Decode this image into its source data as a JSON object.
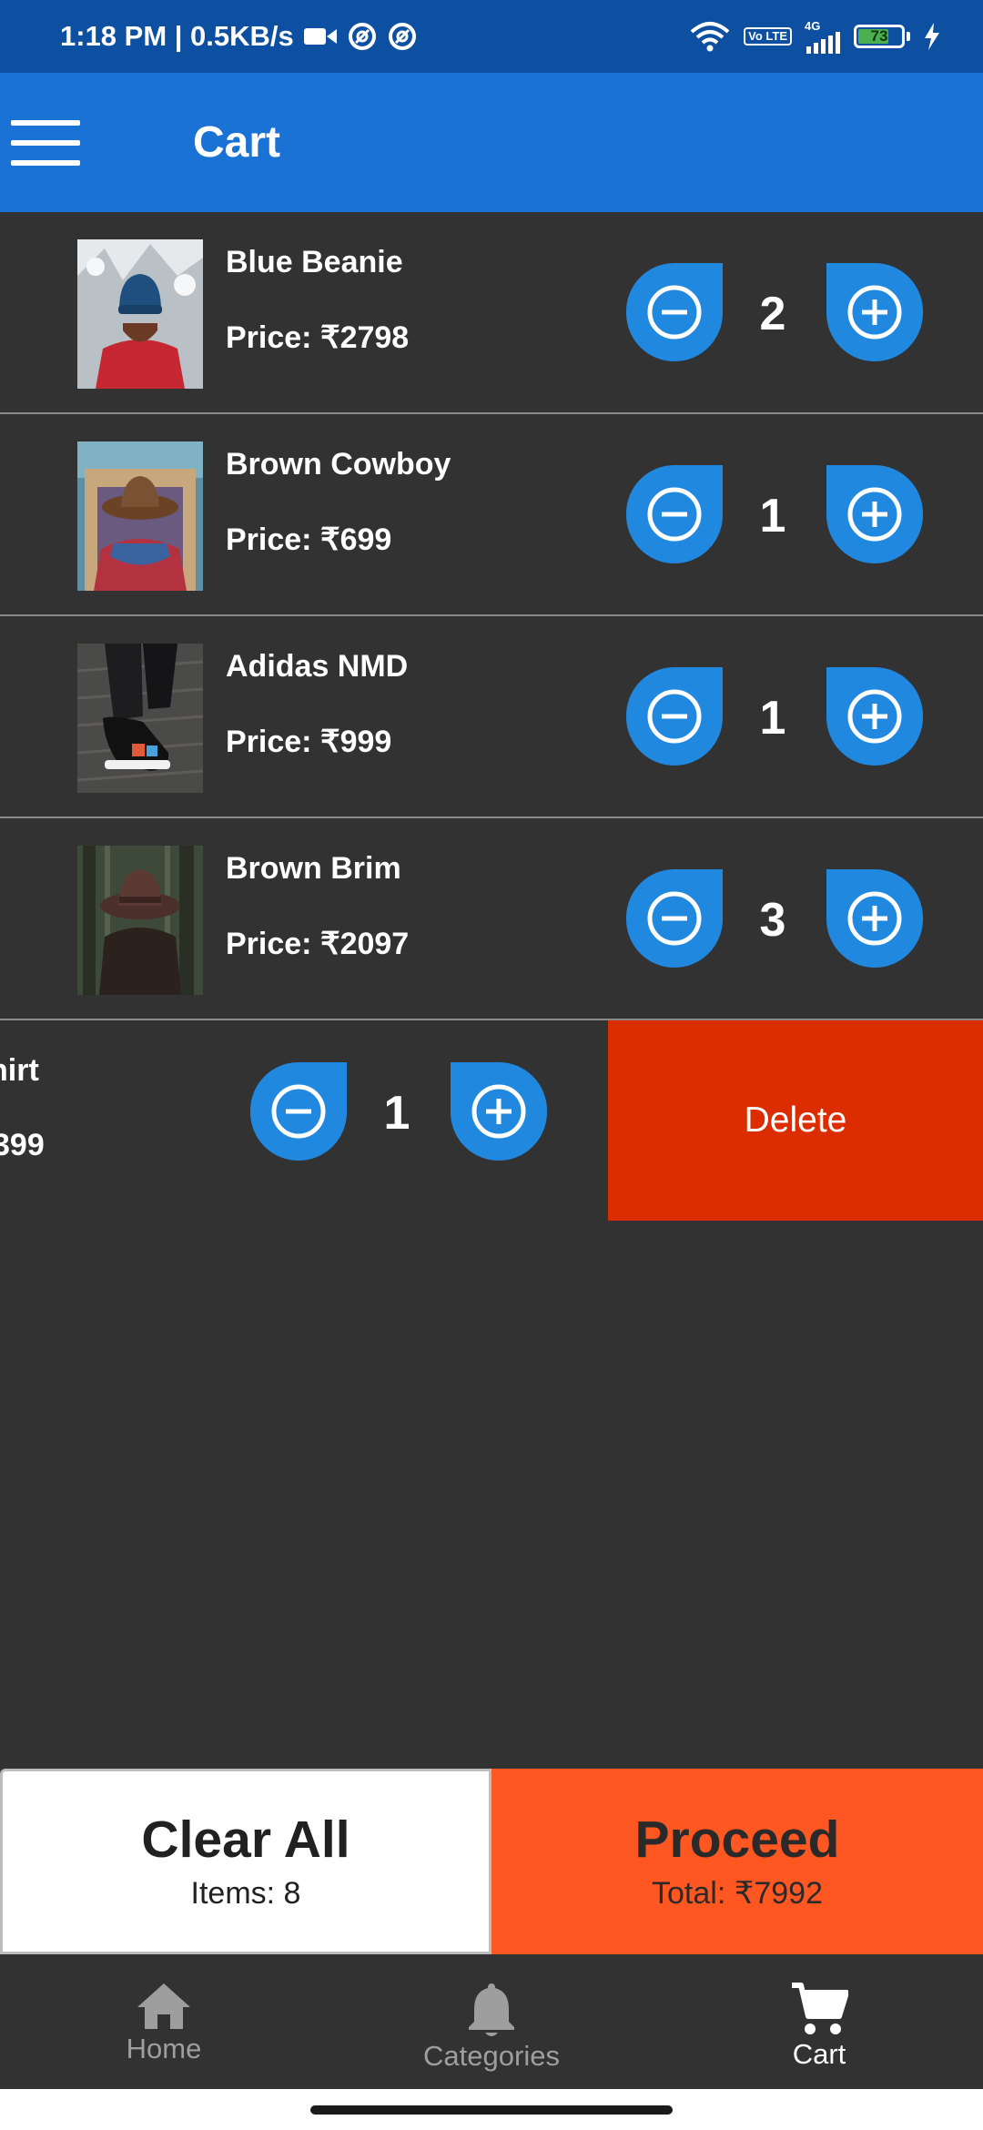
{
  "status_bar": {
    "time_speed": "1:18 PM | 0.5KB/s",
    "network_type": "4G",
    "volte": "Vo LTE",
    "battery_level": "73",
    "battery_fraction": 0.73
  },
  "header": {
    "title": "Cart"
  },
  "cart_items": [
    {
      "name": "Blue Beanie",
      "price": "Price:  ₹2798",
      "qty": "2"
    },
    {
      "name": "Brown Cowboy",
      "price": "Price:  ₹699",
      "qty": "1"
    },
    {
      "name": "Adidas NMD",
      "price": "Price:  ₹999",
      "qty": "1"
    },
    {
      "name": "Brown Brim",
      "price": "Price:  ₹2097",
      "qty": "3"
    },
    {
      "name_fragment": "hirt",
      "price_fragment": "399",
      "qty": "1",
      "delete_label": "Delete"
    }
  ],
  "actions": {
    "clear_label": "Clear All",
    "items_text": "Items: 8",
    "proceed_label": "Proceed",
    "total_text": "Total: ₹7992"
  },
  "bottom_nav": {
    "home": "Home",
    "categories": "Categories",
    "cart": "Cart"
  },
  "colors": {
    "status_bar": "#0d4fa0",
    "app_bar": "#1a73d4",
    "qty_button": "#2188e0",
    "delete": "#dc2d00",
    "proceed": "#ff5722",
    "background": "#323232"
  }
}
